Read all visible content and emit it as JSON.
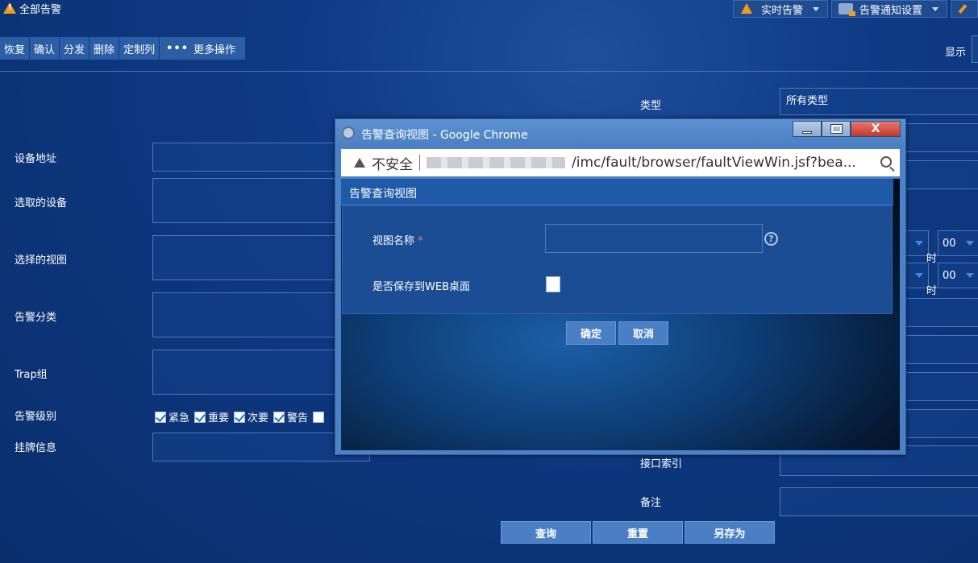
{
  "app": {
    "title": "全部告警"
  },
  "top_buttons": {
    "realtime": "实时告警",
    "notify": "告警通知设置"
  },
  "toolbar": {
    "restore": "恢复",
    "confirm": "确认",
    "dispatch": "分发",
    "delete": "删除",
    "custom_columns": "定制列",
    "more_dots": "•••",
    "more_ops": "更多操作",
    "display": "显示"
  },
  "form": {
    "device_address": "设备地址",
    "selected_devices": "选取的设备",
    "selected_views": "选择的视图",
    "alarm_category": "告警分类",
    "trap_group": "Trap组",
    "alarm_level": "告警级别",
    "tag_info": "挂牌信息",
    "levels": [
      {
        "label": "紧急",
        "checked": true
      },
      {
        "label": "重要",
        "checked": true
      },
      {
        "label": "次要",
        "checked": true
      },
      {
        "label": "警告",
        "checked": true
      },
      {
        "label": "",
        "checked": false
      }
    ],
    "type_label": "类型",
    "type_value": "所有类型",
    "hour_value_1": "00",
    "hour_value_2": "00",
    "hour_unit": "时",
    "interface_index": "接口索引",
    "remark": "备注"
  },
  "bottom": {
    "query": "查询",
    "reset": "重置",
    "save_as": "另存为"
  },
  "popup": {
    "window_title": "告警查询视图 - Google Chrome",
    "insecure": "不安全",
    "url": "/imc/fault/browser/faultViewWin.jsf?bea...",
    "dialog_title": "告警查询视图",
    "view_name_label": "视图名称",
    "required_mark": "*",
    "help_glyph": "?",
    "save_web_label": "是否保存到WEB桌面",
    "ok": "确定",
    "cancel": "取消",
    "close_glyph": "X"
  },
  "colors": {
    "background": "#0f3a85",
    "button": "#4a7fc6",
    "warning": "#f39a1e"
  }
}
